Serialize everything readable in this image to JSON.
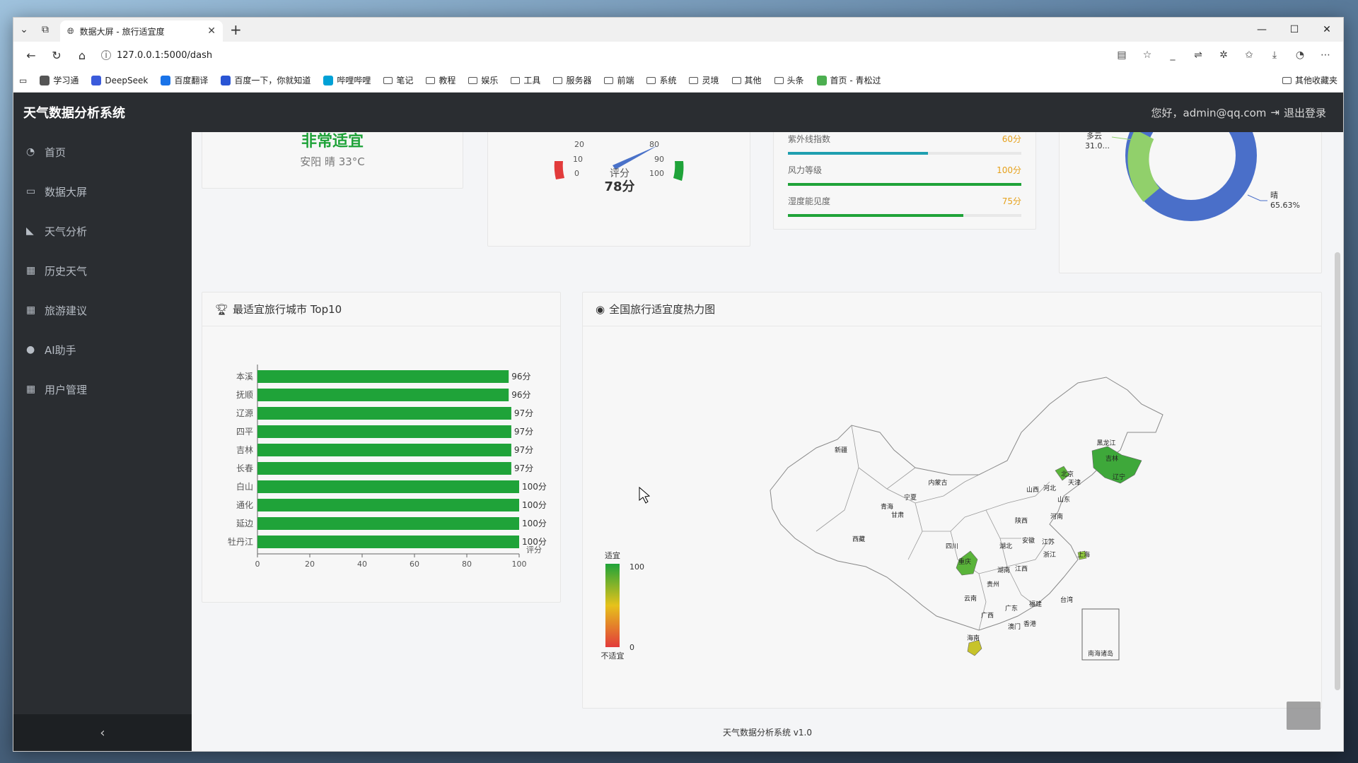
{
  "browser": {
    "tab_title": "数据大屏 - 旅行适宜度",
    "url": "127.0.0.1:5000/dash",
    "bookmarks": [
      "学习通",
      "DeepSeek",
      "百度翻译",
      "百度一下，你就知道",
      "哔哩哔哩",
      "笔记",
      "教程",
      "娱乐",
      "工具",
      "服务器",
      "前端",
      "系统",
      "灵境",
      "其他",
      "头条",
      "首页 - 青松过"
    ],
    "other_bookmarks": "其他收藏夹"
  },
  "app": {
    "title": "天气数据分析系统",
    "user_text": "您好，admin@qq.com",
    "logout": "退出登录",
    "footer": "天气数据分析系统 v1.0"
  },
  "sidebar": {
    "items": [
      {
        "label": "首页",
        "icon": "dashboard-icon"
      },
      {
        "label": "数据大屏",
        "icon": "monitor-icon"
      },
      {
        "label": "天气分析",
        "icon": "area-chart-icon"
      },
      {
        "label": "历史天气",
        "icon": "table-icon"
      },
      {
        "label": "旅游建议",
        "icon": "table-icon"
      },
      {
        "label": "AI助手",
        "icon": "chat-icon"
      },
      {
        "label": "用户管理",
        "icon": "table-icon"
      }
    ],
    "collapse": "‹"
  },
  "summary": {
    "verdict": "非常适宜",
    "city_weather": "安阳 晴 33°C"
  },
  "gauge": {
    "label": "评分",
    "value_text": "78分",
    "ticks": [
      "20",
      "10",
      "0",
      "80",
      "90",
      "100"
    ]
  },
  "indices": [
    {
      "label": "紫外线指数",
      "value_text": "60分",
      "value": 60
    },
    {
      "label": "风力等级",
      "value_text": "100分",
      "value": 100
    },
    {
      "label": "湿度能见度",
      "value_text": "75分",
      "value": 75
    }
  ],
  "donut": {
    "labels": [
      {
        "name": "多云",
        "pct": "31.0..."
      },
      {
        "name": "晴",
        "pct": "65.63%"
      }
    ]
  },
  "top10": {
    "title": "最适宜旅行城市 Top10",
    "x_axis_name": "评分"
  },
  "heatmap": {
    "title": "全国旅行适宜度热力图",
    "legend_high": "适宜",
    "legend_low": "不适宜",
    "legend_max": "100",
    "legend_min": "0",
    "nanhai": "南海诸岛",
    "provinces": [
      "新疆",
      "西藏",
      "青海",
      "甘肃",
      "宁夏",
      "内蒙古",
      "黑龙江",
      "吉林",
      "辽宁",
      "北京",
      "天津",
      "河北",
      "山西",
      "山东",
      "河南",
      "陕西",
      "四川",
      "重庆",
      "湖北",
      "安徽",
      "江苏",
      "上海",
      "浙江",
      "湖南",
      "江西",
      "贵州",
      "云南",
      "广西",
      "广东",
      "福建",
      "台湾",
      "澳门",
      "香港",
      "海南"
    ]
  },
  "chart_data": {
    "type": "bar",
    "orientation": "horizontal",
    "categories": [
      "本溪",
      "抚顺",
      "辽源",
      "四平",
      "吉林",
      "长春",
      "白山",
      "通化",
      "延边",
      "牡丹江"
    ],
    "values": [
      96,
      96,
      97,
      97,
      97,
      97,
      100,
      100,
      100,
      100
    ],
    "value_suffix": "分",
    "xlim": [
      0,
      100
    ],
    "x_ticks": [
      0,
      20,
      40,
      60,
      80,
      100
    ],
    "xlabel": "评分",
    "color": "#1fa339"
  }
}
